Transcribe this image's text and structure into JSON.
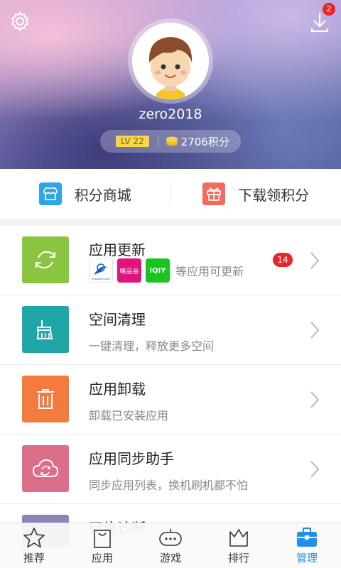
{
  "header": {
    "username": "zero2018",
    "level": "LV 22",
    "points": "2706积分",
    "download_badge": "2"
  },
  "quick_actions": [
    {
      "label": "积分商城",
      "icon": "store-icon",
      "color": "#2fa6e6"
    },
    {
      "label": "下载领积分",
      "icon": "gift-icon",
      "color": "#f26b5b"
    }
  ],
  "list": {
    "app_update": {
      "title": "应用更新",
      "subtitle": "等应用可更新",
      "badge": "14",
      "mini_apps": [
        "zuiyoubo.com",
        "唯品会",
        "iQIY"
      ],
      "color": "#8ac53f"
    },
    "space_clean": {
      "title": "空间清理",
      "subtitle": "一键清理，释放更多空间",
      "color": "#21a6a8"
    },
    "uninstall": {
      "title": "应用卸载",
      "subtitle": "卸载已安装应用",
      "color": "#f47a3e"
    },
    "sync": {
      "title": "应用同步助手",
      "subtitle": "同步应用列表，换机刷机都不怕",
      "color": "#dc6e8a"
    },
    "partial": {
      "title": "网络诊断",
      "color": "#8a84b8"
    }
  },
  "tabbar": [
    {
      "label": "推荐",
      "icon": "star-icon",
      "active": false
    },
    {
      "label": "应用",
      "icon": "shopping-bag-icon",
      "active": false
    },
    {
      "label": "游戏",
      "icon": "gamepad-icon",
      "active": false
    },
    {
      "label": "排行",
      "icon": "crown-icon",
      "active": false
    },
    {
      "label": "管理",
      "icon": "toolbox-icon",
      "active": true
    }
  ],
  "colors": {
    "accent": "#1f8fe8",
    "badge": "#e8262a"
  }
}
